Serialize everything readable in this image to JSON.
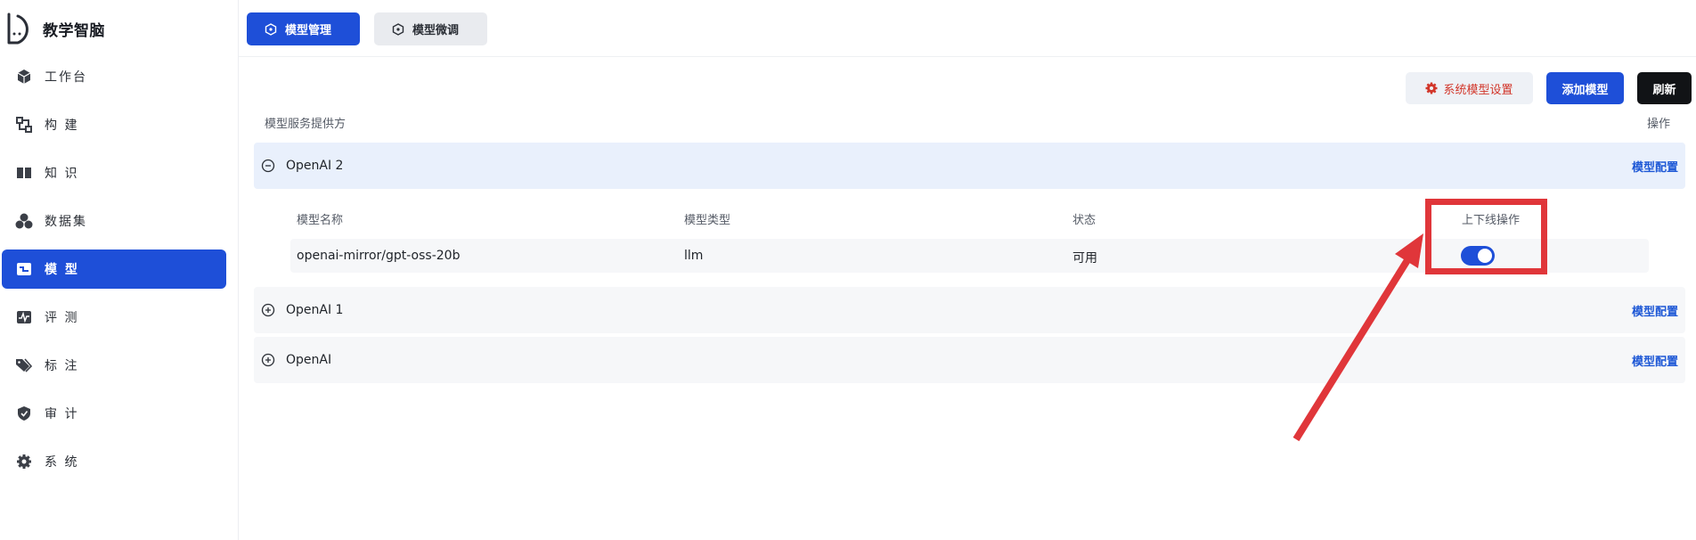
{
  "app": {
    "title": "教学智脑"
  },
  "colors": {
    "accent": "#1e4fd8",
    "danger": "#d2362a",
    "annotation": "#e0363a"
  },
  "sidebar": {
    "items": [
      {
        "label": "工作台",
        "icon": "cube-icon",
        "active": false
      },
      {
        "label": "构  建",
        "icon": "build-icon",
        "active": false
      },
      {
        "label": "知  识",
        "icon": "book-icon",
        "active": false
      },
      {
        "label": "数据集",
        "icon": "dataset-icon",
        "active": false
      },
      {
        "label": "模  型",
        "icon": "model-icon",
        "active": true
      },
      {
        "label": "评  测",
        "icon": "pulse-icon",
        "active": false
      },
      {
        "label": "标  注",
        "icon": "tag-icon",
        "active": false
      },
      {
        "label": "审  计",
        "icon": "shield-icon",
        "active": false
      },
      {
        "label": "系  统",
        "icon": "gear-icon",
        "active": false
      }
    ]
  },
  "tabs": [
    {
      "label": "模型管理",
      "active": true
    },
    {
      "label": "模型微调",
      "active": false
    }
  ],
  "toolbar": {
    "system_settings": "系统模型设置",
    "add_model": "添加模型",
    "refresh": "刷新"
  },
  "table": {
    "provider_header": "模型服务提供方",
    "ops_header": "操作"
  },
  "providers": [
    {
      "name": "OpenAI 2",
      "expanded": true,
      "config_label": "模型配置",
      "columns": [
        "模型名称",
        "模型类型",
        "状态",
        "上下线操作"
      ],
      "models": [
        {
          "name": "openai-mirror/gpt-oss-20b",
          "type": "llm",
          "status": "可用",
          "online": true
        }
      ]
    },
    {
      "name": "OpenAI 1",
      "expanded": false,
      "config_label": "模型配置"
    },
    {
      "name": "OpenAI",
      "expanded": false,
      "config_label": "模型配置"
    }
  ]
}
